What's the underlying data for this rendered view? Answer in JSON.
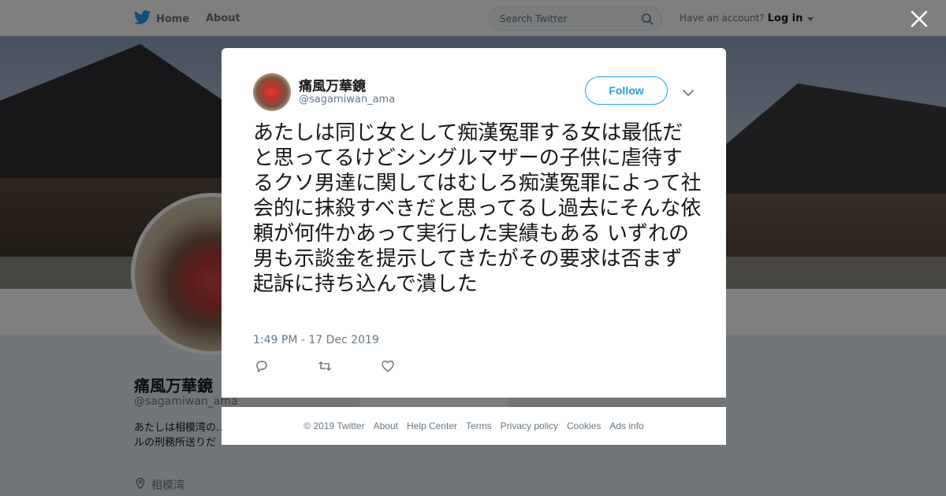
{
  "topbar": {
    "home_label": "Home",
    "about_label": "About",
    "search_placeholder": "Search Twitter",
    "have_account": "Have an account?",
    "login_label": "Log in"
  },
  "profile": {
    "name": "痛風万華鏡",
    "handle": "@sagamiwan_ama",
    "bio": "あたしは相模湾の…ても何度でも蘇る…ラジルの刑務所送りだ",
    "location": "相模湾"
  },
  "tweet": {
    "author_name": "痛風万華鏡",
    "author_handle": "@sagamiwan_ama",
    "follow_label": "Follow",
    "text": "あたしは同じ女として痴漢冤罪する女は最低だと思ってるけどシングルマザーの子供に虐待するクソ男達に関してはむしろ痴漢冤罪によって社会的に抹殺すべきだと思ってるし過去にそんな依頼が何件かあって実行した実績もある いずれの男も示談金を提示してきたがその要求は否まず起訴に持ち込んで潰した",
    "timestamp": "1:49 PM - 17 Dec 2019"
  },
  "footer": {
    "links": [
      "© 2019 Twitter",
      "About",
      "Help Center",
      "Terms",
      "Privacy policy",
      "Cookies",
      "Ads info"
    ]
  },
  "colors": {
    "brand": "#1da1f2",
    "secondary_text": "#657786",
    "overlay": "rgba(0,0,0,0.5)"
  },
  "icons": [
    "twitter-bird-icon",
    "search-icon",
    "close-icon",
    "chevron-down-icon",
    "reply-icon",
    "retweet-icon",
    "like-icon",
    "location-icon"
  ]
}
